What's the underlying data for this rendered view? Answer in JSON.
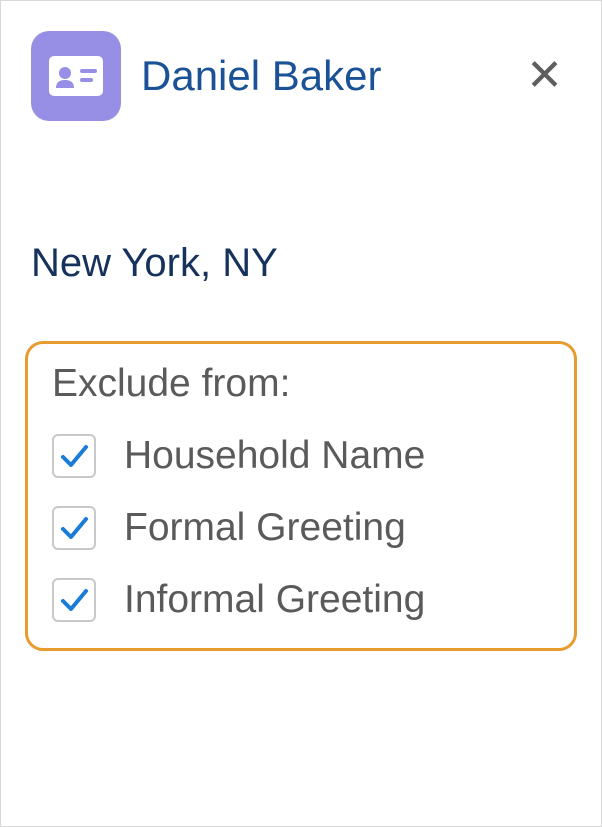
{
  "header": {
    "name": "Daniel Baker"
  },
  "location": "New York, NY",
  "exclude": {
    "title": "Exclude from:",
    "options": [
      {
        "label": "Household Name",
        "checked": true
      },
      {
        "label": "Formal Greeting",
        "checked": true
      },
      {
        "label": "Informal Greeting",
        "checked": true
      }
    ]
  }
}
